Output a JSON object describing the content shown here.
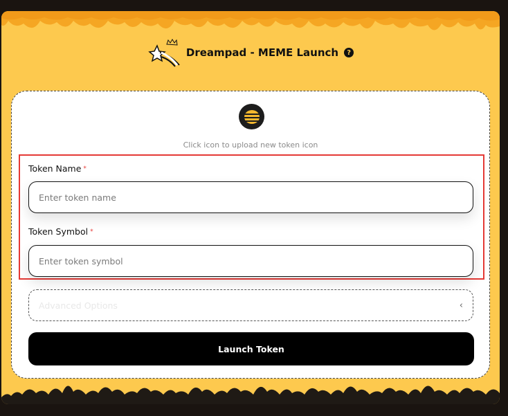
{
  "header": {
    "title": "Dreampad - MEME Launch",
    "logo_icon": "shooting-star-icon",
    "help_icon": "question-circle-icon",
    "help_glyph": "?"
  },
  "form": {
    "upload_hint": "Click icon to upload new token icon",
    "token_icon": "beehive-icon",
    "required_marker": "*",
    "token_name": {
      "label": "Token Name",
      "placeholder": "Enter token name",
      "value": ""
    },
    "token_symbol": {
      "label": "Token Symbol",
      "placeholder": "Enter token symbol",
      "value": ""
    },
    "advanced": {
      "label": "Advanced Options",
      "chevron_icon": "chevron-left-icon",
      "chevron_glyph": "‹"
    },
    "launch_label": "Launch Token"
  },
  "colors": {
    "honey": "#fdc94e",
    "background": "#1a1410",
    "highlight": "#e53935",
    "button": "#000000"
  }
}
